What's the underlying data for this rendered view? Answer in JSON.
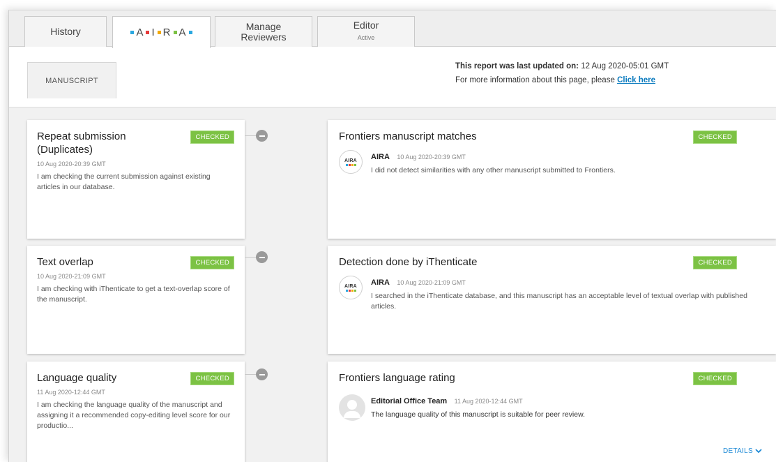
{
  "tabs": [
    {
      "label": "History",
      "sub": ""
    },
    {
      "label": "A I R A",
      "sub": ""
    },
    {
      "label": "Manage Reviewers",
      "sub": ""
    },
    {
      "label": "Editor",
      "sub": "Active"
    }
  ],
  "logo": {
    "letters": [
      "A",
      "I",
      "R",
      "A"
    ],
    "dot_colors": [
      "#2aa8e0",
      "#e63b3b",
      "#f2a900",
      "#7cc244",
      "#2aa8e0"
    ]
  },
  "manuscript_tab": "MANUSCRIPT",
  "update": {
    "label": "This report was last updated on:",
    "value": "12 Aug 2020-05:01 GMT",
    "info_prefix": "For more information about this page, please",
    "link": "Click here"
  },
  "checks": [
    {
      "title": "Repeat submission (Duplicates)",
      "status": "CHECKED",
      "timestamp": "10 Aug 2020-20:39 GMT",
      "description": "I am checking the current submission against existing articles in our database."
    },
    {
      "title": "Text overlap",
      "status": "CHECKED",
      "timestamp": "10 Aug 2020-21:09 GMT",
      "description": "I am checking with iThenticate to get a text-overlap score of the manuscript."
    },
    {
      "title": "Language quality",
      "status": "CHECKED",
      "timestamp": "11 Aug 2020-12:44 GMT",
      "description": "I am checking the language quality of the manuscript and assigning it a recommended copy-editing level score for our productio..."
    }
  ],
  "results": [
    {
      "title": "Frontiers manuscript matches",
      "status": "CHECKED",
      "author": "AIRA",
      "timestamp": "10 Aug 2020-20:39 GMT",
      "message": "I did not detect similarities with any other manuscript submitted to Frontiers."
    },
    {
      "title": "Detection done by iThenticate",
      "status": "CHECKED",
      "author": "AIRA",
      "timestamp": "10 Aug 2020-21:09 GMT",
      "message": "I searched in the iThenticate database, and this manuscript has an acceptable level of textual overlap with published articles."
    },
    {
      "title": "Frontiers language rating",
      "status": "CHECKED",
      "author": "Editorial Office Team",
      "timestamp": "11 Aug 2020-12:44 GMT",
      "message": "The language quality of this manuscript is suitable for peer review.",
      "details_label": "DETAILS"
    }
  ],
  "avatar_text": "AIRA",
  "colors": {
    "checked_badge": "#7cc244",
    "link": "#0b7bbf",
    "details": "#1e8ad6"
  }
}
